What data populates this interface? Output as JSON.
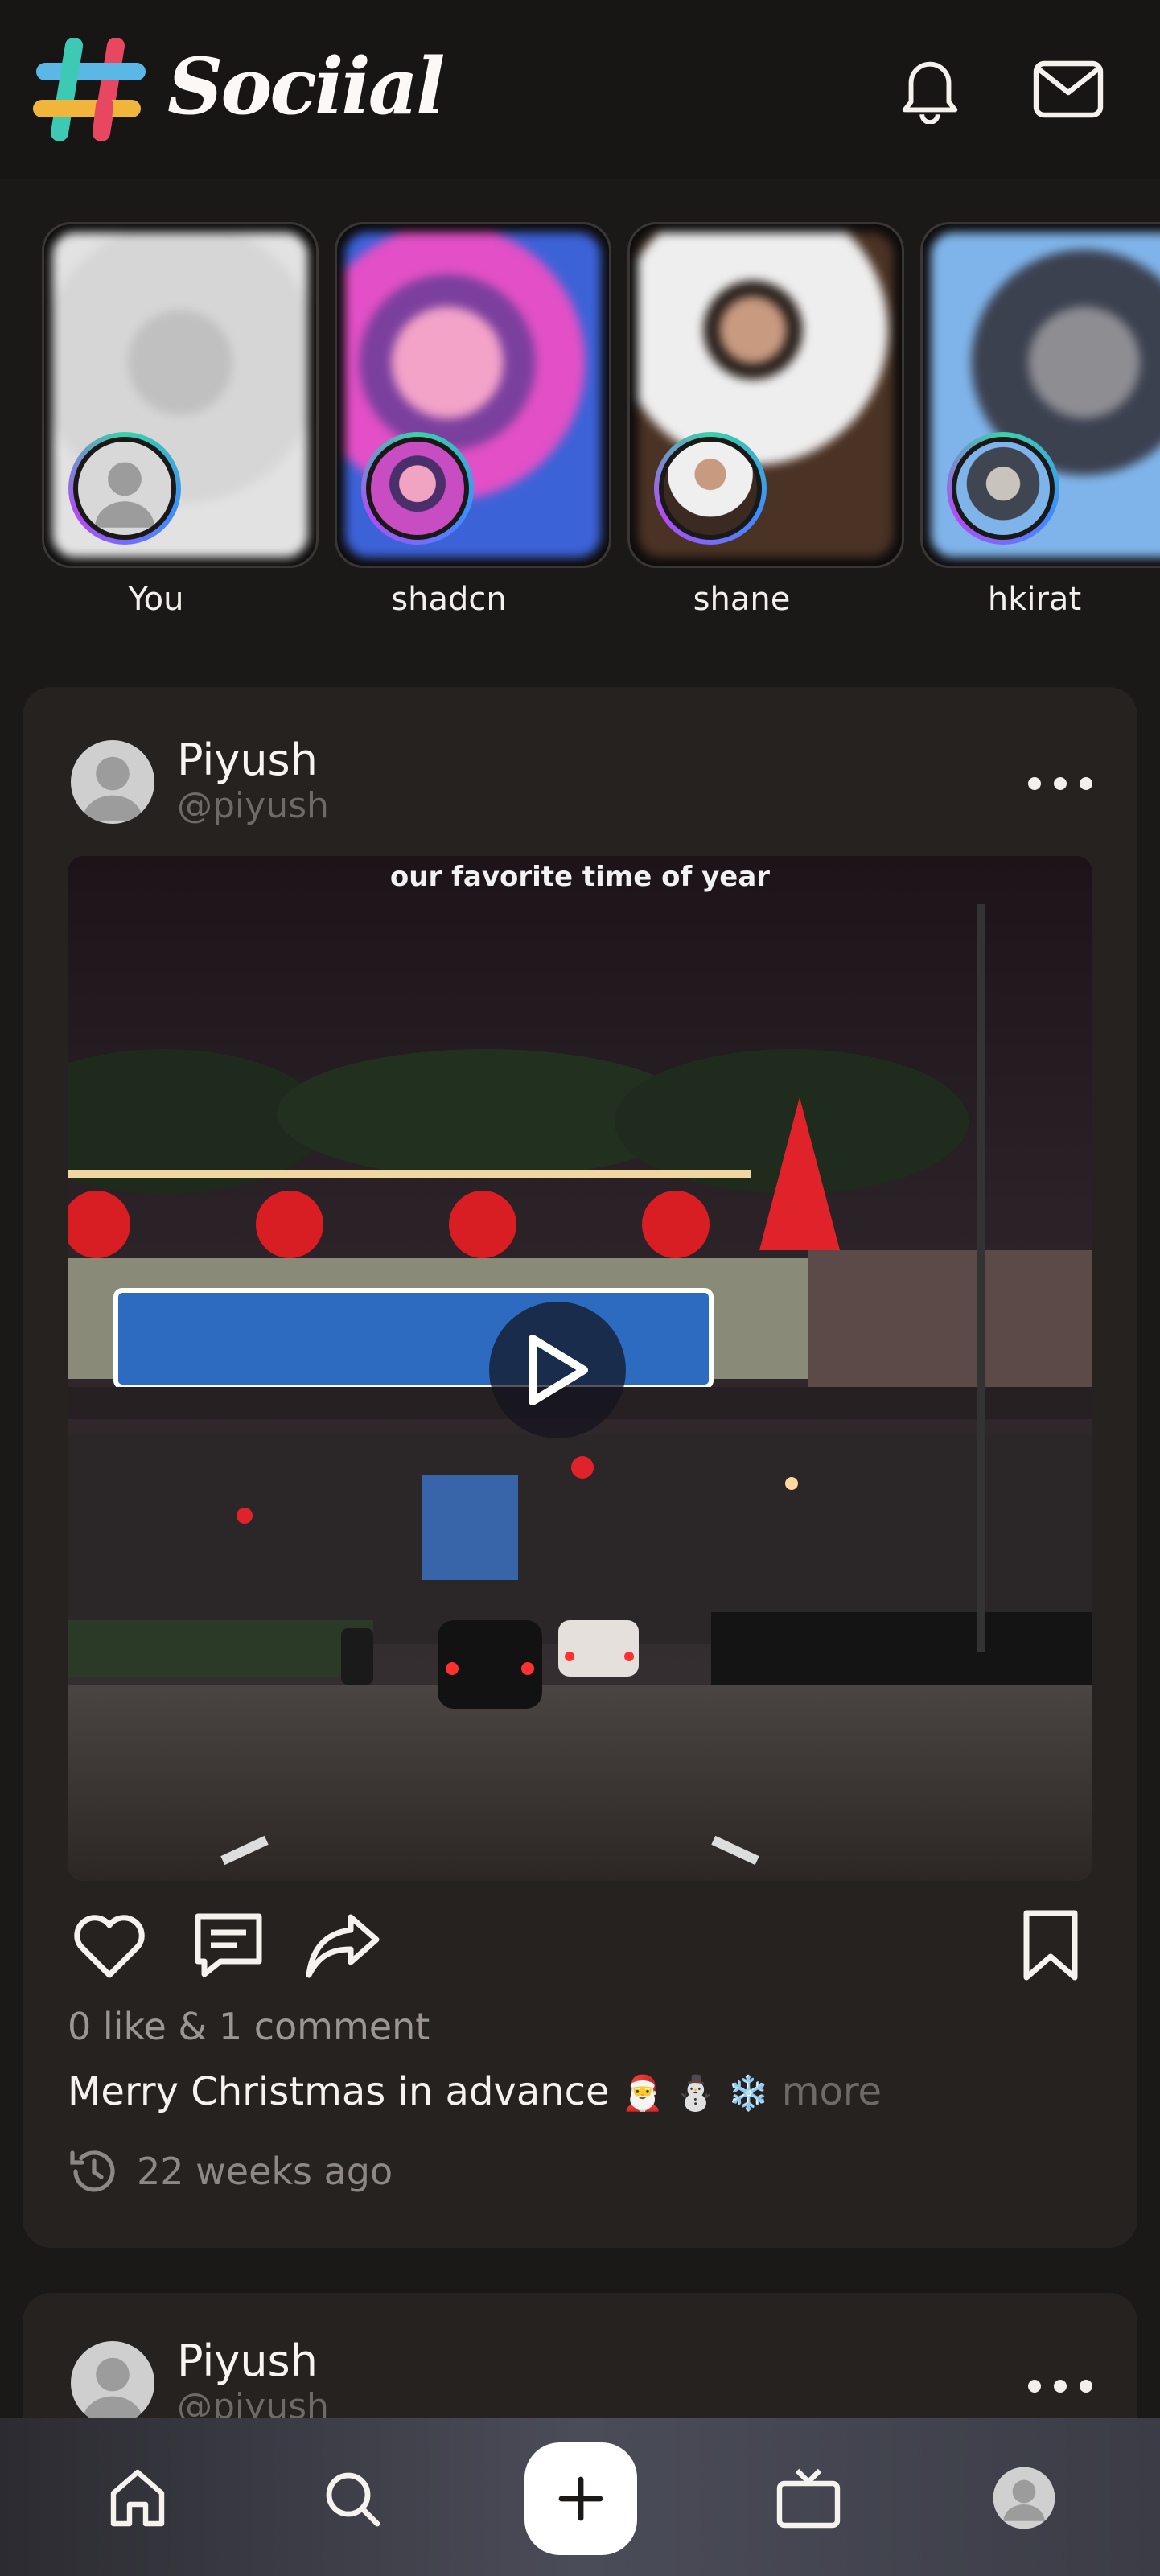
{
  "app": {
    "name": "Sociial"
  },
  "stories": [
    {
      "label": "You"
    },
    {
      "label": "shadcn"
    },
    {
      "label": "shane"
    },
    {
      "label": "hkirat"
    }
  ],
  "posts": [
    {
      "author_name": "Piyush",
      "author_handle": "@piyush",
      "media_caption": "our favorite time of year",
      "stats": "0 like & 1 comment",
      "caption": "Merry Christmas in advance",
      "caption_emojis": "🎅 ⛄ ❄️",
      "more_label": "more",
      "time": "22 weeks ago"
    },
    {
      "author_name": "Piyush",
      "author_handle": "@piyush"
    }
  ],
  "colors": {
    "background": "#1b1918",
    "card": "#252220",
    "text": "#f4f1ee",
    "muted": "#8d8884"
  },
  "icons": {
    "header": [
      "bell-icon",
      "mail-icon"
    ],
    "post_actions": [
      "heart-icon",
      "comment-icon",
      "share-icon",
      "bookmark-icon"
    ],
    "nav": [
      "home-icon",
      "search-icon",
      "plus-icon",
      "tv-icon",
      "profile-icon"
    ]
  }
}
